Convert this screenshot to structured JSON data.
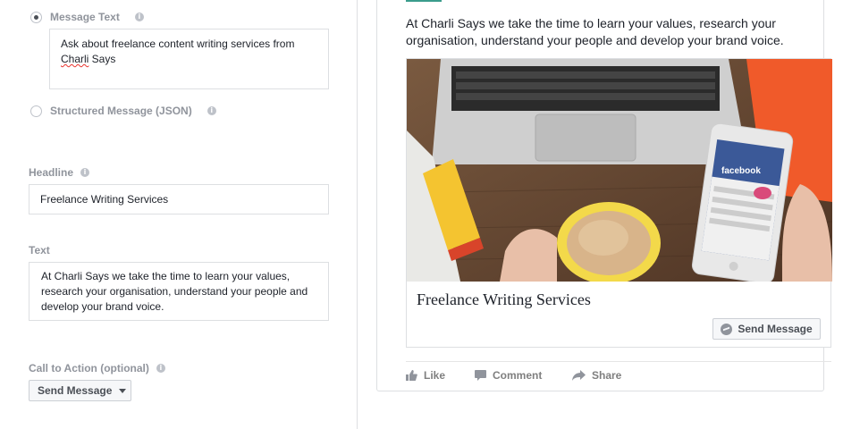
{
  "left": {
    "message_text": {
      "label": "Message Text",
      "value_part1": "Ask about freelance content writing services from ",
      "value_misspelled": "Charli",
      "value_part2": " Says",
      "checked": true
    },
    "structured_message": {
      "label": "Structured Message (JSON)",
      "checked": false
    },
    "headline": {
      "label": "Headline",
      "value": "Freelance Writing Services"
    },
    "text": {
      "label": "Text",
      "value": "At Charli Says we take the time to learn your values, research your organisation, understand your people and develop your brand voice."
    },
    "cta": {
      "label": "Call to Action (optional)",
      "selected": "Send Message"
    },
    "info_icon": "i"
  },
  "preview": {
    "post_text": "At Charli Says we take the time to learn your values, research your organisation, understand your people and develop your brand voice.",
    "attachment_title": "Freelance Writing Services",
    "send_button": "Send Message",
    "phone_brand": "facebook",
    "actions": {
      "like": "Like",
      "comment": "Comment",
      "share": "Share"
    }
  },
  "colors": {
    "accent_teal": "#3b9c8c",
    "facebook_blue": "#3b5998",
    "muted_label": "#90949c"
  },
  "icons": [
    "info-icon",
    "radio-icon",
    "messenger-icon",
    "like-icon",
    "comment-icon",
    "share-icon",
    "caret-down-icon"
  ]
}
